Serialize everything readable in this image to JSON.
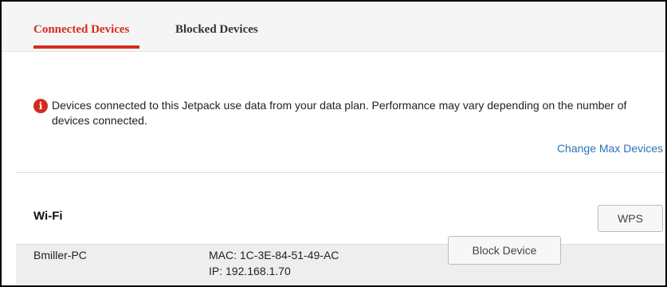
{
  "tabs": [
    {
      "label": "Connected Devices",
      "active": true
    },
    {
      "label": "Blocked Devices",
      "active": false
    }
  ],
  "notice": {
    "icon": "info-icon",
    "icon_glyph": "i",
    "text": "Devices connected to this Jetpack use data from your data plan. Performance may vary depending on the number of devices connected."
  },
  "change_max_devices_label": "Change Max Devices",
  "wifi": {
    "title": "Wi-Fi",
    "wps_label": "WPS",
    "devices": [
      {
        "name": "Bmiller-PC",
        "mac": "MAC: 1C-3E-84-51-49-AC",
        "ip": "IP: 192.168.1.70",
        "action_label": "Block Device"
      }
    ]
  },
  "colors": {
    "accent": "#d52b1e",
    "link": "#2b73b7",
    "tab_bar_bg": "#f5f5f5",
    "row_bg": "#eeeeee"
  }
}
